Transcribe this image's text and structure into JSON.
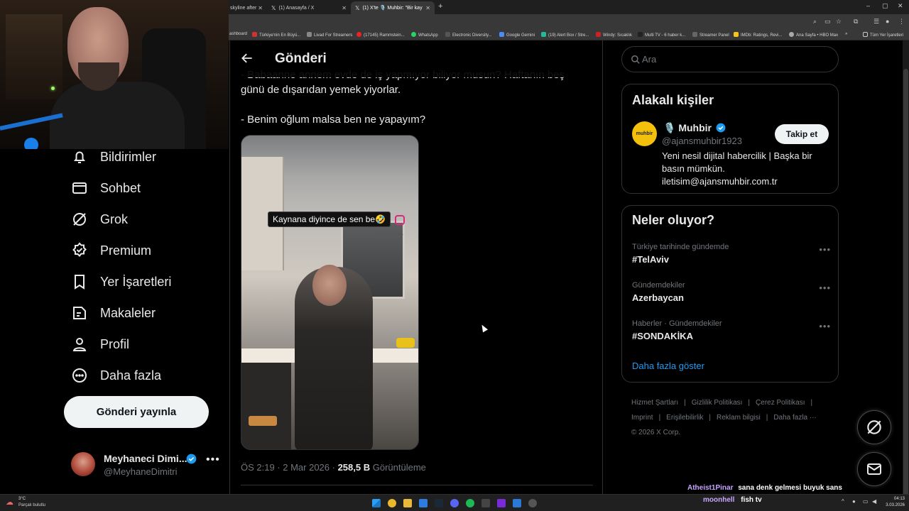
{
  "browser": {
    "tabs": [
      {
        "title": "skyline after",
        "active": false
      },
      {
        "title": "(1) Anasayfa / X",
        "active": false
      },
      {
        "title": "(1) X'te 🎙️ Muhbir: \"Bir kay",
        "active": true
      }
    ],
    "bookmarks": [
      "ashboard",
      "Türkiye'nin En Büyü...",
      "Livad For Streamers",
      "(17145) Rammstein...",
      "WhatsApp",
      "Electronic Diversity...",
      "Google Gemini",
      "(19) Alert Box / Stre...",
      "Windy: Sıcaklık",
      "Multi TV - 6 haber k...",
      "Streamer Panel",
      "IMDb: Ratings, Revi...",
      "Ana Sayfa • HBO Max",
      "»",
      "Tüm Yer İşaretleri"
    ]
  },
  "nav": {
    "items": [
      {
        "label": "Bildirimler",
        "icon": "bell-icon"
      },
      {
        "label": "Sohbet",
        "icon": "mail-icon"
      },
      {
        "label": "Grok",
        "icon": "grok-icon"
      },
      {
        "label": "Premium",
        "icon": "premium-badge-icon"
      },
      {
        "label": "Yer İşaretleri",
        "icon": "bookmark-icon"
      },
      {
        "label": "Makaleler",
        "icon": "article-icon"
      },
      {
        "label": "Profil",
        "icon": "profile-icon"
      },
      {
        "label": "Daha fazla",
        "icon": "more-circle-icon"
      }
    ],
    "post_button": "Gönderi yayınla",
    "account": {
      "name": "Meyhaneci Dimi...",
      "handle": "@MeyhaneDimitri",
      "more": "•••"
    }
  },
  "post": {
    "header_title": "Gönderi",
    "text_lines": [
      "- Babaanne annem evde de iş yapmıyor biliyor musun? Haftanın beş",
      "günü de dışarıdan yemek yiyorlar.",
      "- Benim oğlum malsa ben ne yapayım?"
    ],
    "media_caption": "Kaynana diyince de sen be🤣",
    "media_watermark": "@BUSSRACAKIL",
    "meta_time": "ÖS 2:19 · 2 Mar 2026 · ",
    "meta_views_count": "258,5 B",
    "meta_views_label": " Görüntüleme"
  },
  "search": {
    "placeholder": "Ara"
  },
  "related": {
    "title": "Alakalı kişiler",
    "avatar_text": "muhbir",
    "name": "🎙️ Muhbir",
    "handle": "@ajansmuhbir1923",
    "bio": "Yeni nesil dijital habercilik | Başka bir basın mümkün. iletisim@ajansmuhbir.com.tr",
    "follow_label": "Takip et"
  },
  "trends": {
    "title": "Neler oluyor?",
    "items": [
      {
        "context": "Türkiye tarihinde gündemde",
        "topic": "#TelAviv"
      },
      {
        "context": "Gündemdekiler",
        "topic": "Azerbaycan"
      },
      {
        "context": "Haberler · Gündemdekiler",
        "topic": "#SONDAKİKA"
      }
    ],
    "show_more": "Daha fazla göster"
  },
  "footer": {
    "links": [
      "Hizmet Şartları",
      "Gizlilik Politikası",
      "Çerez Politikası",
      "Imprint",
      "Erişilebilirlik",
      "Reklam bilgisi",
      "Daha fazla ···"
    ],
    "copyright": "© 2026 X Corp."
  },
  "chat": [
    {
      "user": "Atheist1Pinar",
      "message": "sana denk gelmesi buyuk sans",
      "color": "#c7a6ff"
    },
    {
      "user": "moonhell",
      "message": "fish tv",
      "color": "#c7a6ff"
    }
  ],
  "taskbar": {
    "weather_temp": "3°C",
    "weather_condition": "Parçalı bulutlu",
    "time": "04:13",
    "date": "3.03.2026"
  },
  "colors": {
    "accent": "#1d9bf0",
    "background": "#000000",
    "border": "#2f3336",
    "muted": "#71767b"
  }
}
